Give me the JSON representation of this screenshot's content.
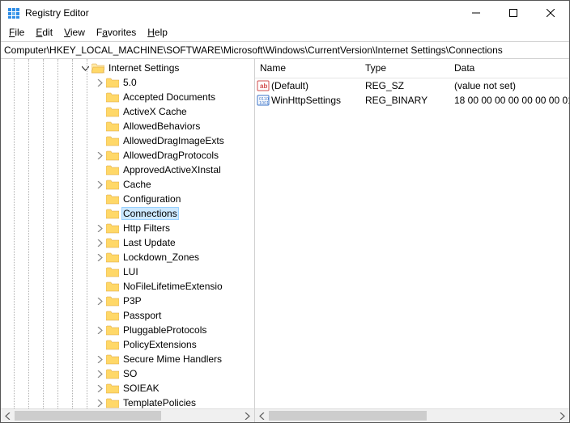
{
  "window": {
    "title": "Registry Editor"
  },
  "menu": {
    "file": "File",
    "edit": "Edit",
    "view": "View",
    "favorites": "Favorites",
    "help": "Help"
  },
  "address": "Computer\\HKEY_LOCAL_MACHINE\\SOFTWARE\\Microsoft\\Windows\\CurrentVersion\\Internet Settings\\Connections",
  "tree": {
    "root_label": "Internet Settings",
    "items": [
      {
        "label": "5.0",
        "expand": "closed"
      },
      {
        "label": "Accepted Documents",
        "expand": "none"
      },
      {
        "label": "ActiveX Cache",
        "expand": "none"
      },
      {
        "label": "AllowedBehaviors",
        "expand": "none"
      },
      {
        "label": "AllowedDragImageExts",
        "expand": "none"
      },
      {
        "label": "AllowedDragProtocols",
        "expand": "closed"
      },
      {
        "label": "ApprovedActiveXInstal",
        "expand": "none"
      },
      {
        "label": "Cache",
        "expand": "closed"
      },
      {
        "label": "Configuration",
        "expand": "none"
      },
      {
        "label": "Connections",
        "expand": "none",
        "selected": true
      },
      {
        "label": "Http Filters",
        "expand": "closed"
      },
      {
        "label": "Last Update",
        "expand": "closed"
      },
      {
        "label": "Lockdown_Zones",
        "expand": "closed"
      },
      {
        "label": "LUI",
        "expand": "none"
      },
      {
        "label": "NoFileLifetimeExtensio",
        "expand": "none"
      },
      {
        "label": "P3P",
        "expand": "closed"
      },
      {
        "label": "Passport",
        "expand": "none"
      },
      {
        "label": "PluggableProtocols",
        "expand": "closed"
      },
      {
        "label": "PolicyExtensions",
        "expand": "none"
      },
      {
        "label": "Secure Mime Handlers",
        "expand": "closed"
      },
      {
        "label": "SO",
        "expand": "closed"
      },
      {
        "label": "SOIEAK",
        "expand": "closed"
      },
      {
        "label": "TemplatePolicies",
        "expand": "closed"
      }
    ]
  },
  "list": {
    "headers": {
      "name": "Name",
      "type": "Type",
      "data": "Data"
    },
    "rows": [
      {
        "icon": "string",
        "name": "(Default)",
        "type": "REG_SZ",
        "data": "(value not set)"
      },
      {
        "icon": "binary",
        "name": "WinHttpSettings",
        "type": "REG_BINARY",
        "data": "18 00 00 00 00 00 00 00 01 00 0"
      }
    ]
  }
}
